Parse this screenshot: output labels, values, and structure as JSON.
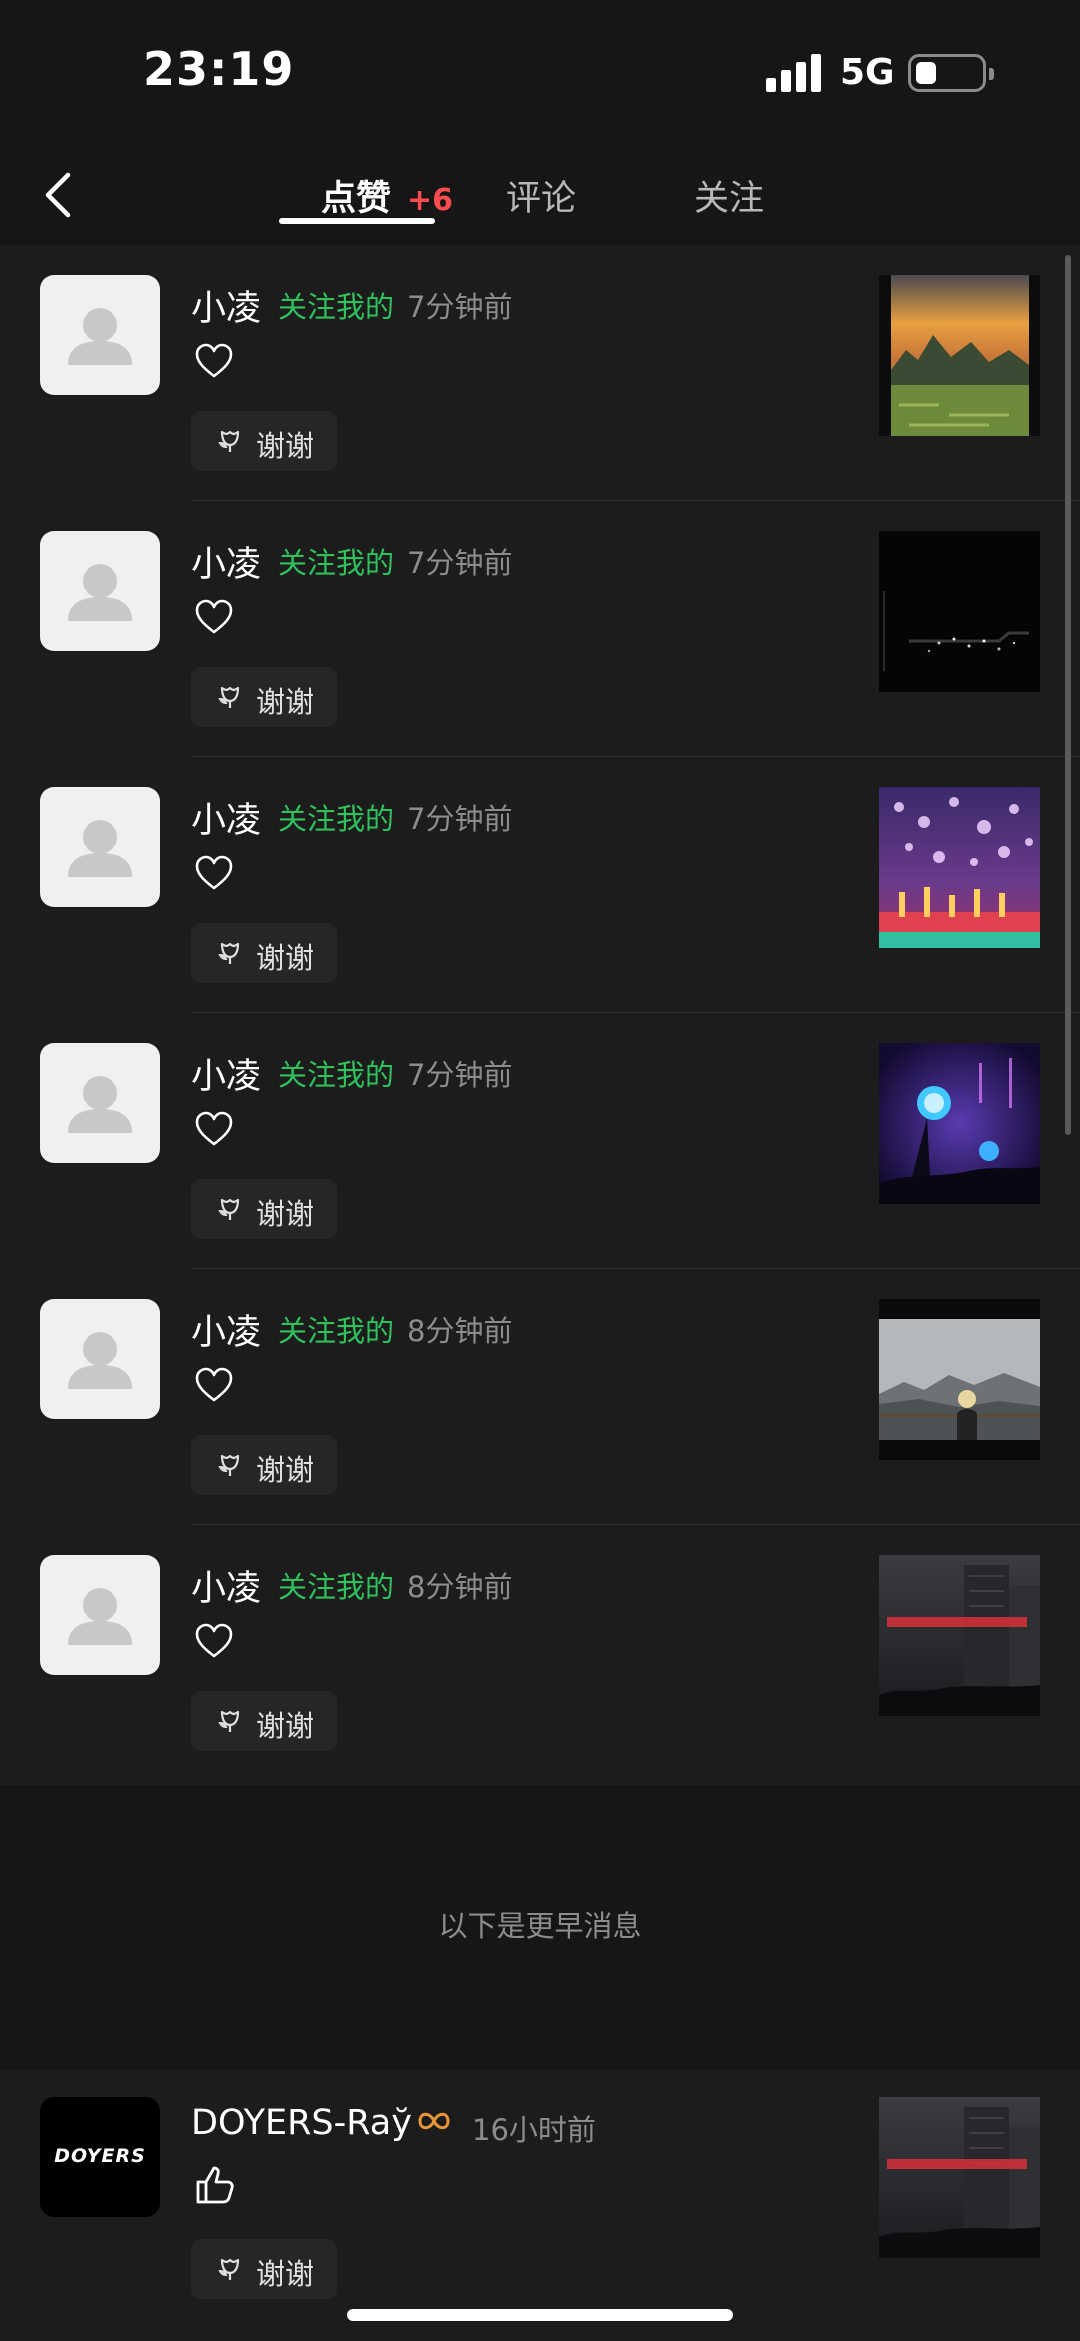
{
  "status": {
    "time": "23:19",
    "network": "5G"
  },
  "nav": {
    "tabs": [
      {
        "label": "点赞",
        "badge": "+6"
      },
      {
        "label": "评论"
      },
      {
        "label": "关注"
      }
    ]
  },
  "notifications": [
    {
      "name": "小凌",
      "relation": "关注我的",
      "time": "7分钟前",
      "thanks_label": "谢谢",
      "thumbnail": "mountain-sunset"
    },
    {
      "name": "小凌",
      "relation": "关注我的",
      "time": "7分钟前",
      "thanks_label": "谢谢",
      "thumbnail": "dark-night-scene"
    },
    {
      "name": "小凌",
      "relation": "关注我的",
      "time": "7分钟前",
      "thanks_label": "谢谢",
      "thumbnail": "colorful-stage-dancers"
    },
    {
      "name": "小凌",
      "relation": "关注我的",
      "time": "7分钟前",
      "thanks_label": "谢谢",
      "thumbnail": "concert-lightstick"
    },
    {
      "name": "小凌",
      "relation": "关注我的",
      "time": "8分钟前",
      "thanks_label": "谢谢",
      "thumbnail": "mountain-selfie"
    },
    {
      "name": "小凌",
      "relation": "关注我的",
      "time": "8分钟前",
      "thanks_label": "谢谢",
      "thumbnail": "night-city-building"
    }
  ],
  "earlier_label": "以下是更早消息",
  "earlier": [
    {
      "name": "DOYERS-Raў",
      "time": "16小时前",
      "avatar_text": "DOYERS",
      "thanks_label": "谢谢",
      "thumbnail": "night-city-building"
    }
  ],
  "colors": {
    "accent_green": "#2fc25b",
    "badge_red": "#ff4d4f",
    "background": "#1c1c1c"
  }
}
